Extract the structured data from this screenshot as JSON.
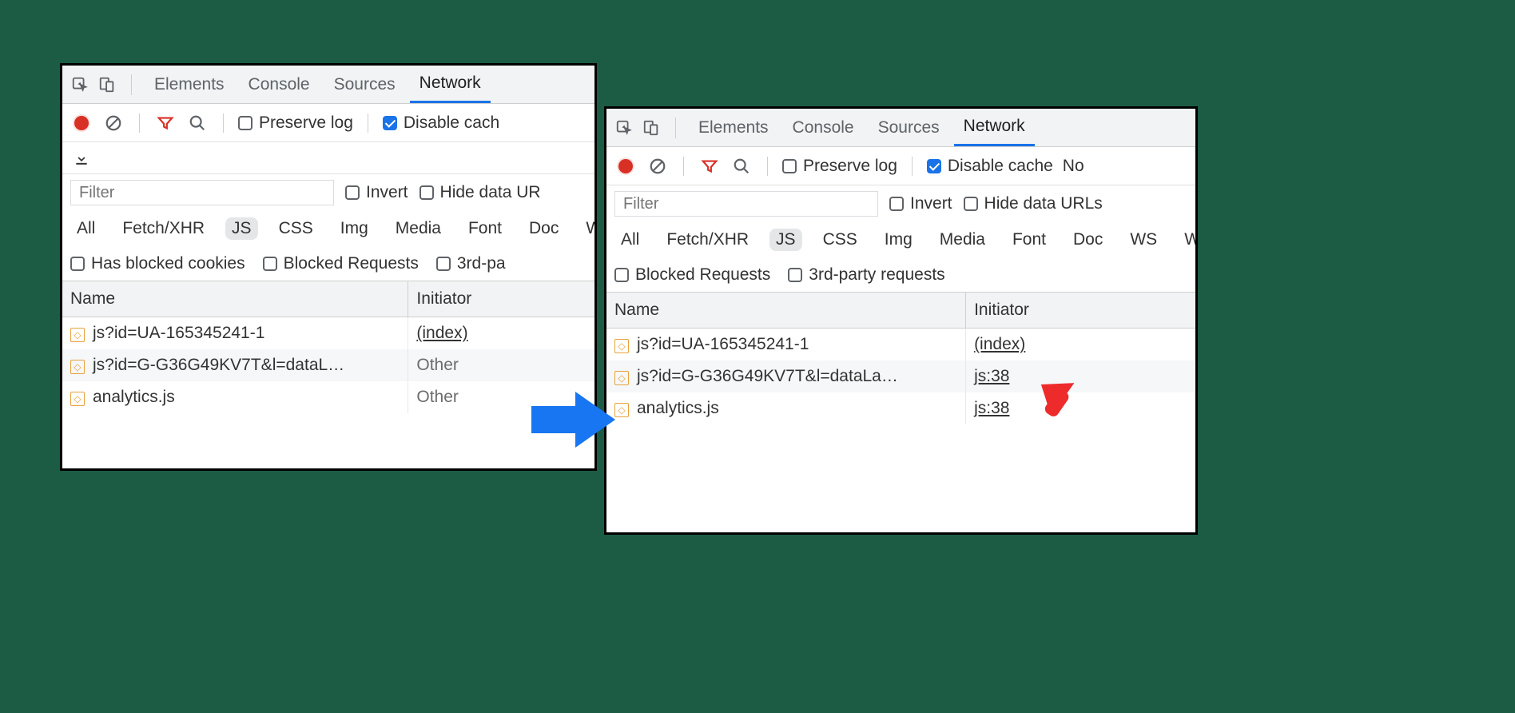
{
  "left": {
    "tabs": {
      "elements": "Elements",
      "console": "Console",
      "sources": "Sources",
      "network": "Network"
    },
    "toolbar": {
      "preserve": "Preserve log",
      "disable": "Disable cach"
    },
    "filter": {
      "placeholder": "Filter",
      "invert": "Invert",
      "hide": "Hide data UR"
    },
    "types": {
      "all": "All",
      "xhr": "Fetch/XHR",
      "js": "JS",
      "css": "CSS",
      "img": "Img",
      "media": "Media",
      "font": "Font",
      "doc": "Doc",
      "ws": "WS"
    },
    "extra": {
      "hbc": "Has blocked cookies",
      "br": "Blocked Requests",
      "tp": "3rd-pa"
    },
    "table": {
      "h_name": "Name",
      "h_init": "Initiator",
      "rows": [
        {
          "name": "js?id=UA-165345241-1",
          "init": "(index)",
          "link": true
        },
        {
          "name": "js?id=G-G36G49KV7T&l=dataL…",
          "init": "Other",
          "link": false
        },
        {
          "name": "analytics.js",
          "init": "Other",
          "link": false
        }
      ]
    }
  },
  "right": {
    "tabs": {
      "elements": "Elements",
      "console": "Console",
      "sources": "Sources",
      "network": "Network"
    },
    "toolbar": {
      "preserve": "Preserve log",
      "disable": "Disable cache",
      "no": "No"
    },
    "filter": {
      "placeholder": "Filter",
      "invert": "Invert",
      "hide": "Hide data URLs"
    },
    "types": {
      "all": "All",
      "xhr": "Fetch/XHR",
      "js": "JS",
      "css": "CSS",
      "img": "Img",
      "media": "Media",
      "font": "Font",
      "doc": "Doc",
      "ws": "WS",
      "wasm": "Wasn"
    },
    "extra": {
      "br": "Blocked Requests",
      "tp": "3rd-party requests"
    },
    "table": {
      "h_name": "Name",
      "h_init": "Initiator",
      "rows": [
        {
          "name": "js?id=UA-165345241-1",
          "init": "(index)",
          "link": true
        },
        {
          "name": "js?id=G-G36G49KV7T&l=dataLa…",
          "init": "js:38",
          "link": true
        },
        {
          "name": "analytics.js",
          "init": "js:38",
          "link": true
        }
      ]
    }
  }
}
